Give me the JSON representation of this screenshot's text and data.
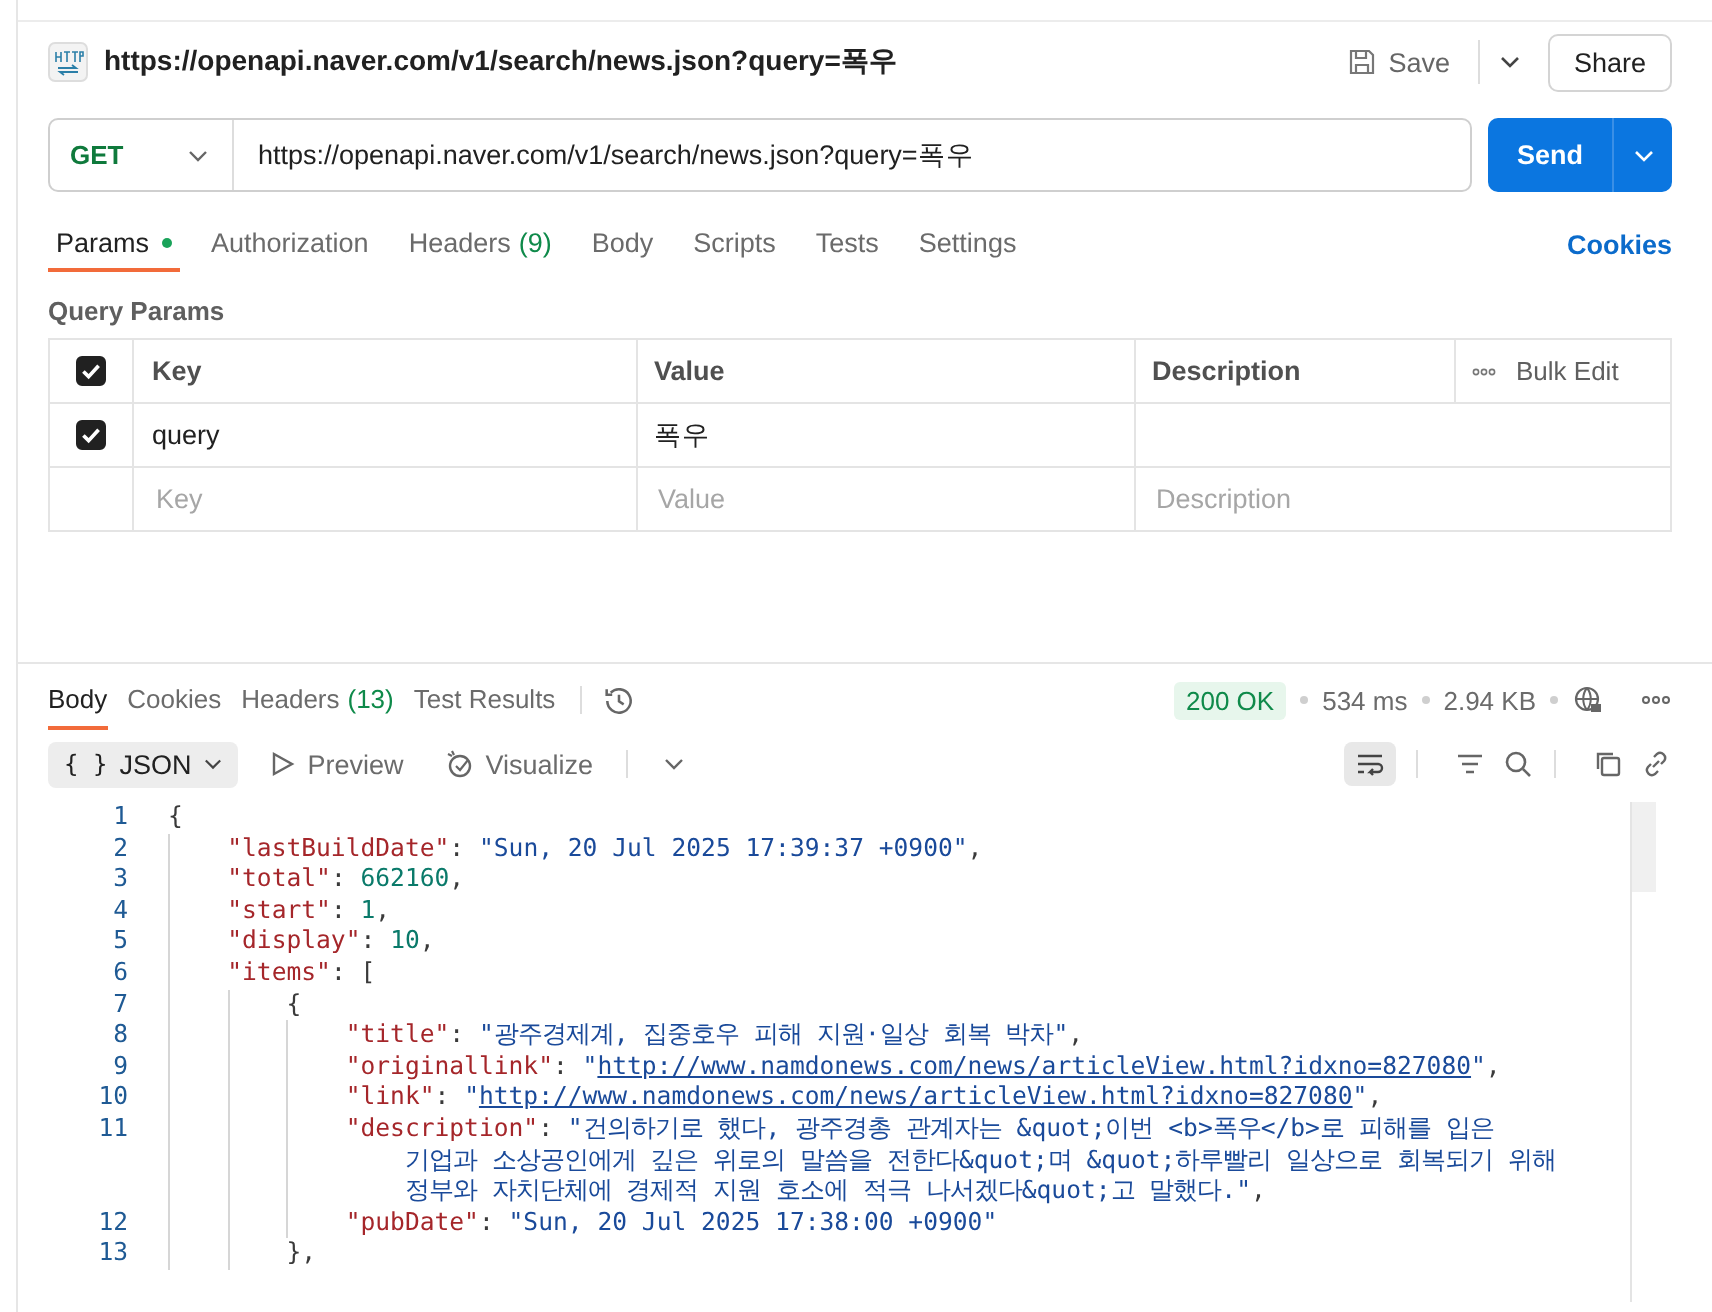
{
  "request": {
    "title": "https://openapi.naver.com/v1/search/news.json?query=폭우",
    "save": "Save",
    "share": "Share",
    "method": "GET",
    "url": "https://openapi.naver.com/v1/search/news.json?query=폭우",
    "send": "Send"
  },
  "request_tabs": [
    {
      "label": "Params",
      "dot": true,
      "selected": true
    },
    {
      "label": "Authorization",
      "dot": false,
      "selected": false
    },
    {
      "label": "Headers",
      "count": "(9)",
      "dot": false,
      "selected": false
    },
    {
      "label": "Body",
      "dot": false,
      "selected": false
    },
    {
      "label": "Scripts",
      "dot": false,
      "selected": false
    },
    {
      "label": "Tests",
      "dot": false,
      "selected": false
    },
    {
      "label": "Settings",
      "dot": false,
      "selected": false
    }
  ],
  "cookies_link": "Cookies",
  "query_params": {
    "title": "Query Params",
    "all_checked": true,
    "columns": [
      "Key",
      "Value",
      "Description"
    ],
    "bulk_edit": "Bulk Edit",
    "rows": [
      {
        "checked": true,
        "key": "query",
        "value": "폭우"
      }
    ],
    "empty_row": [
      {
        "placeholder": "Key"
      },
      {
        "placeholder": "Value"
      },
      {
        "placeholder": "Description"
      }
    ]
  },
  "response_tabs": [
    {
      "label": "Body",
      "selected": true
    },
    {
      "label": "Cookies",
      "selected": false
    },
    {
      "label": "Headers",
      "count": "(13)",
      "selected": false
    },
    {
      "label": "Test Results",
      "selected": false
    }
  ],
  "response_status": {
    "status": "200 OK",
    "time": "534 ms",
    "size": "2.94 KB"
  },
  "format_icon": "{ }",
  "format": "JSON",
  "preview": "Preview",
  "visualize": "Visualize",
  "code": [
    {
      "number": "1",
      "tokens": [
        {
          "kind": "punct",
          "text": "{"
        }
      ],
      "children": [
        {
          "number": "2",
          "tokens": [
            {
              "kind": "key",
              "text": "\"lastBuildDate\""
            },
            {
              "kind": "punct",
              "text": ": "
            },
            {
              "kind": "string",
              "text": "\"Sun, 20 Jul 2025 17:39:37 +0900\""
            },
            {
              "kind": "punct",
              "text": ","
            }
          ]
        },
        {
          "number": "3",
          "tokens": [
            {
              "kind": "key",
              "text": "\"total\""
            },
            {
              "kind": "punct",
              "text": ": "
            },
            {
              "kind": "number",
              "text": "662160"
            },
            {
              "kind": "punct",
              "text": ","
            }
          ]
        },
        {
          "number": "4",
          "tokens": [
            {
              "kind": "key",
              "text": "\"start\""
            },
            {
              "kind": "punct",
              "text": ": "
            },
            {
              "kind": "number",
              "text": "1"
            },
            {
              "kind": "punct",
              "text": ","
            }
          ]
        },
        {
          "number": "5",
          "tokens": [
            {
              "kind": "key",
              "text": "\"display\""
            },
            {
              "kind": "punct",
              "text": ": "
            },
            {
              "kind": "number",
              "text": "10"
            },
            {
              "kind": "punct",
              "text": ","
            }
          ]
        },
        {
          "number": "6",
          "tokens": [
            {
              "kind": "key",
              "text": "\"items\""
            },
            {
              "kind": "punct",
              "text": ": ["
            }
          ],
          "children": [
            {
              "number": "7",
              "tokens": [
                {
                  "kind": "punct",
                  "text": "{"
                }
              ],
              "children": [
                {
                  "number": "8",
                  "tokens": [
                    {
                      "kind": "key",
                      "text": "\"title\""
                    },
                    {
                      "kind": "punct",
                      "text": ": "
                    },
                    {
                      "kind": "string",
                      "text": "\"광주경제계, 집중호우 피해 지원·일상 회복 박차\""
                    },
                    {
                      "kind": "punct",
                      "text": ","
                    }
                  ]
                },
                {
                  "number": "9",
                  "tokens": [
                    {
                      "kind": "key",
                      "text": "\"originallink\""
                    },
                    {
                      "kind": "punct",
                      "text": ": "
                    },
                    {
                      "kind": "string",
                      "text": "\""
                    },
                    {
                      "kind": "link",
                      "text": "http://www.namdonews.com/news/articleView.html?idxno=827080"
                    },
                    {
                      "kind": "string",
                      "text": "\""
                    },
                    {
                      "kind": "punct",
                      "text": ","
                    }
                  ]
                },
                {
                  "number": "10",
                  "tokens": [
                    {
                      "kind": "key",
                      "text": "\"link\""
                    },
                    {
                      "kind": "punct",
                      "text": ": "
                    },
                    {
                      "kind": "string",
                      "text": "\""
                    },
                    {
                      "kind": "link",
                      "text": "http://www.namdonews.com/news/articleView.html?idxno=827080"
                    },
                    {
                      "kind": "string",
                      "text": "\""
                    },
                    {
                      "kind": "punct",
                      "text": ","
                    }
                  ]
                },
                {
                  "number": "11",
                  "tokens": [
                    {
                      "kind": "key",
                      "text": "\"description\""
                    },
                    {
                      "kind": "punct",
                      "text": ": "
                    },
                    {
                      "kind": "string",
                      "text": "\"건의하기로 했다, 광주경총 관계자는 &quot;이번 <b>폭우</b>로 피해를 입은"
                    }
                  ],
                  "continuation": [
                    [
                      {
                        "kind": "string",
                        "text": "기업과 소상공인에게 깊은 위로의 말씀을 전한다&quot;며 &quot;하루빨리 일상으로 회복되기 위해"
                      }
                    ],
                    [
                      {
                        "kind": "string",
                        "text": "정부와 자치단체에 경제적 지원 호소에 적극 나서겠다&quot;고 말했다.\""
                      },
                      {
                        "kind": "punct",
                        "text": ","
                      }
                    ]
                  ]
                },
                {
                  "number": "12",
                  "tokens": [
                    {
                      "kind": "key",
                      "text": "\"pubDate\""
                    },
                    {
                      "kind": "punct",
                      "text": ": "
                    },
                    {
                      "kind": "string",
                      "text": "\"Sun, 20 Jul 2025 17:38:00 +0900\""
                    }
                  ]
                }
              ]
            },
            {
              "number": "13",
              "tokens": [
                {
                  "kind": "punct",
                  "text": "},"
                }
              ]
            }
          ]
        }
      ]
    }
  ]
}
